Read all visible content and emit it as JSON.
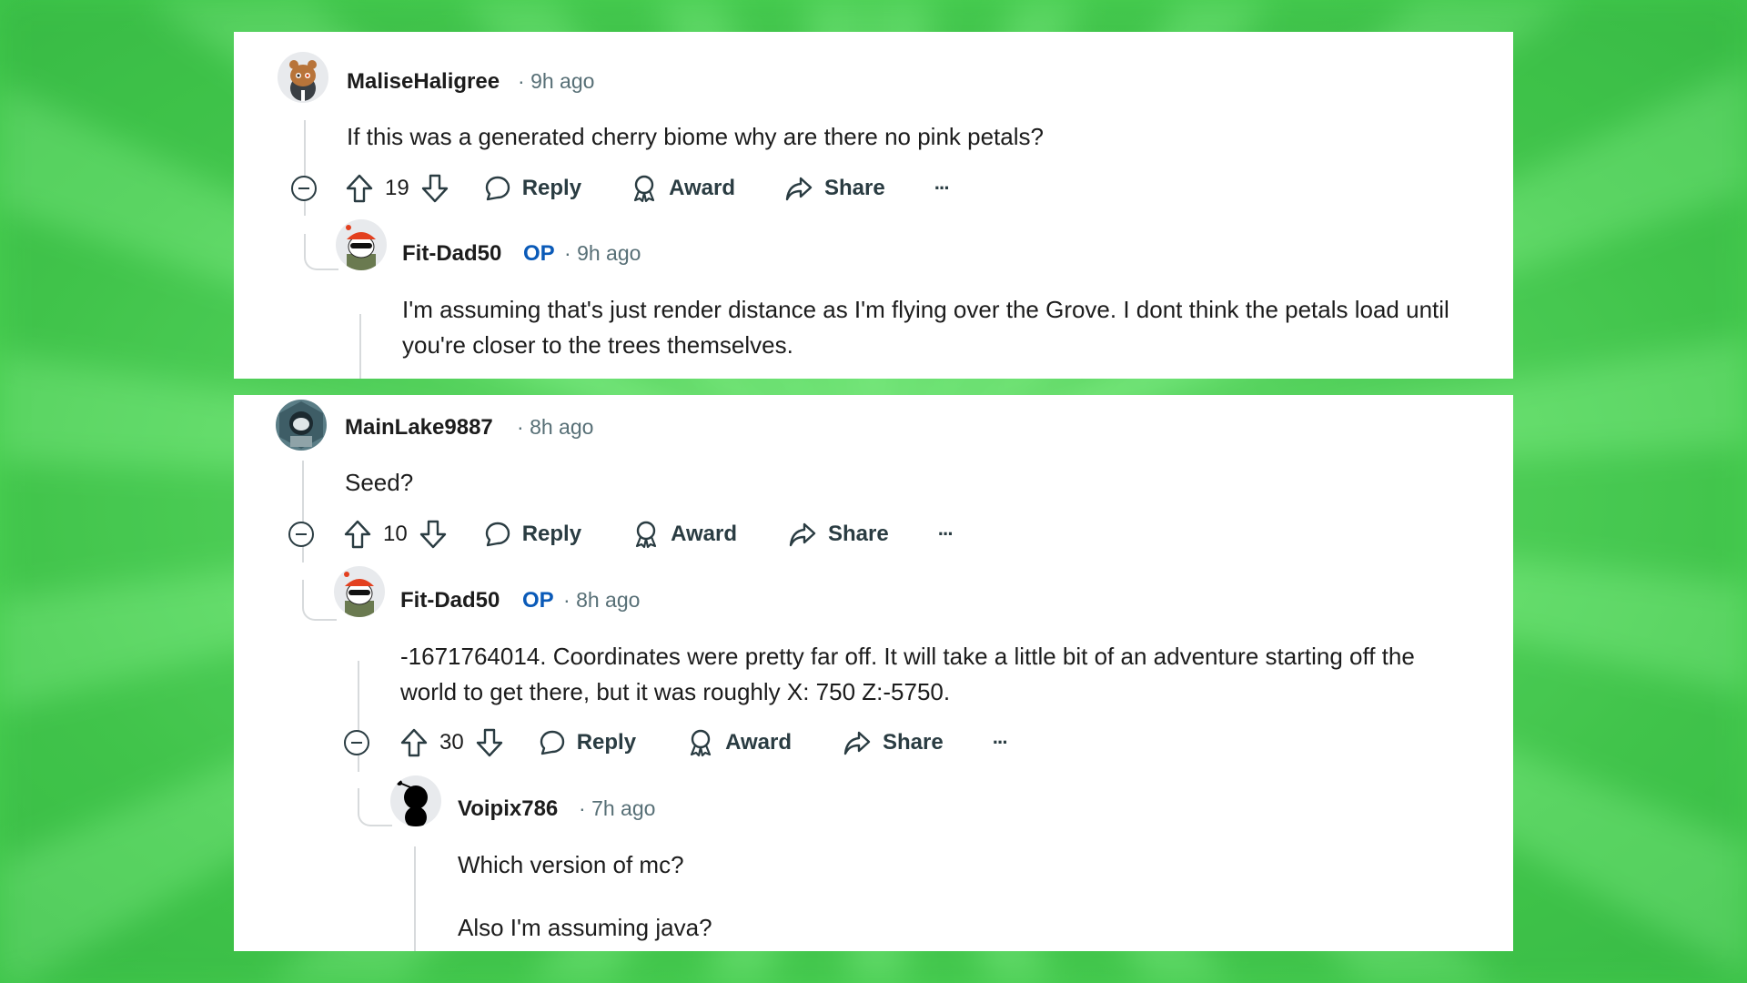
{
  "thread1": {
    "comment": {
      "username": "MaliseHaligree",
      "time": "9h ago",
      "text": "If this was a generated cherry biome why are there no pink petals?",
      "votes": "19",
      "reply_label": "Reply",
      "award_label": "Award",
      "share_label": "Share",
      "more_label": "···"
    },
    "reply": {
      "username": "Fit-Dad50",
      "badge": "OP",
      "time": "9h ago",
      "text": "I'm assuming that's just render distance as I'm flying over the Grove. I dont think the petals load until you're closer to the trees themselves."
    }
  },
  "thread2": {
    "comment": {
      "username": "MainLake9887",
      "time": "8h ago",
      "text": "Seed?",
      "votes": "10",
      "reply_label": "Reply",
      "award_label": "Award",
      "share_label": "Share",
      "more_label": "···"
    },
    "reply": {
      "username": "Fit-Dad50",
      "badge": "OP",
      "time": "8h ago",
      "text": "-1671764014. Coordinates were pretty far off. It will take a little bit of an adventure starting off the world to get there, but it was roughly X: 750 Z:-5750.",
      "votes": "30",
      "reply_label": "Reply",
      "award_label": "Award",
      "share_label": "Share",
      "more_label": "···"
    },
    "nested_reply": {
      "username": "Voipix786",
      "time": "7h ago",
      "text_line1": "Which version of mc?",
      "text_line2": "Also I'm assuming java?"
    }
  },
  "colors": {
    "background_green": "#5fe066",
    "op_blue": "#0a5ab8",
    "meta_gray": "#576f76",
    "text_dark": "#1c1c1c"
  }
}
